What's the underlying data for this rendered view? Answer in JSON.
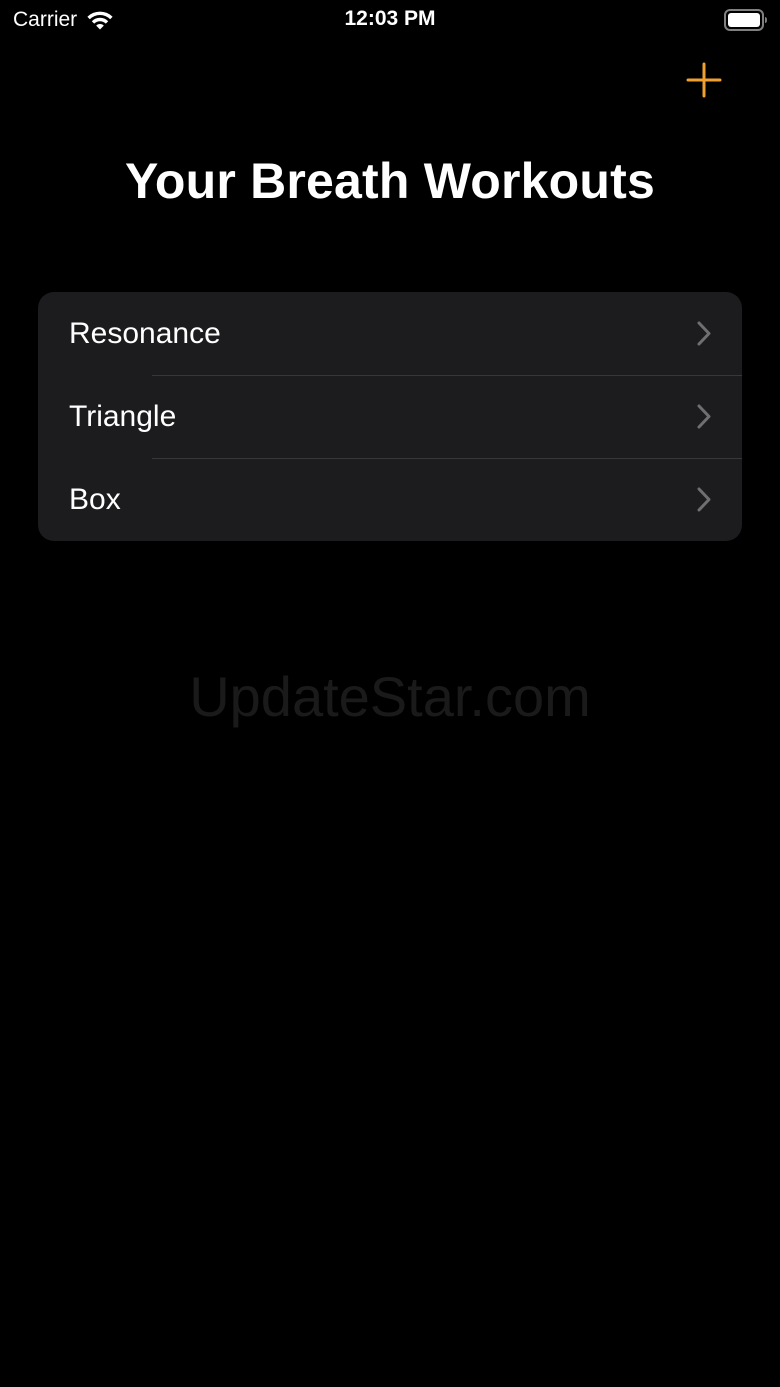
{
  "status_bar": {
    "carrier": "Carrier",
    "time": "12:03 PM",
    "wifi_icon": "wifi-icon",
    "battery_icon": "battery-icon"
  },
  "nav": {
    "add_icon": "plus-icon",
    "accent_color": "#f0a030"
  },
  "page": {
    "title": "Your Breath Workouts"
  },
  "workouts": {
    "items": [
      {
        "label": "Resonance"
      },
      {
        "label": "Triangle"
      },
      {
        "label": "Box"
      }
    ],
    "chevron_icon": "chevron-right-icon"
  },
  "watermark": "UpdateStar.com",
  "colors": {
    "background": "#000000",
    "cell_background": "#1c1c1e",
    "separator": "#38383a",
    "chevron": "#6e6e73"
  }
}
